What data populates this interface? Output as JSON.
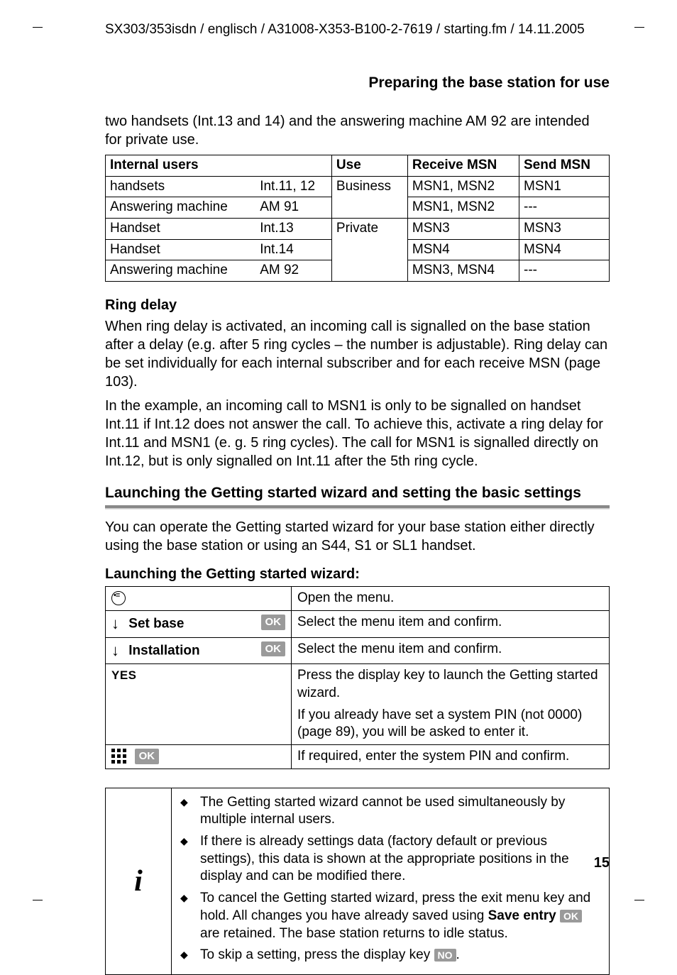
{
  "header_path": "SX303/353isdn / englisch / A31008-X353-B100-2-7619 / starting.fm / 14.11.2005",
  "section_title": "Preparing the base station for use",
  "intro_para": "two handsets (Int.13 and 14) and the answering machine AM 92 are intended for private use.",
  "table1": {
    "headers": [
      "Internal users",
      "",
      "Use",
      "Receive MSN",
      "Send MSN"
    ],
    "rows": [
      [
        "handsets",
        "Int.11, 12",
        "Business",
        "MSN1, MSN2",
        "MSN1"
      ],
      [
        "Answering machine",
        "AM 91",
        "",
        "MSN1, MSN2",
        "---"
      ],
      [
        "Handset",
        "Int.13",
        "Private",
        "MSN3",
        "MSN3"
      ],
      [
        "Handset",
        "Int.14",
        "",
        "MSN4",
        "MSN4"
      ],
      [
        "Answering machine",
        "AM 92",
        "",
        "MSN3, MSN4",
        "---"
      ]
    ]
  },
  "ring_delay": {
    "heading": "Ring delay",
    "p1": "When ring delay is activated, an incoming call is signalled on the base station after a delay (e.g. after 5 ring cycles – the number is adjustable). Ring delay can be set individually for each internal subscriber and for each receive MSN (page 103).",
    "p2": "In the example, an incoming call to MSN1 is only to be signalled on handset Int.11 if Int.12 does not answer the call. To achieve this, activate a ring delay for Int.11 and MSN1 (e. g. 5 ring cycles). The call for MSN1 is signalled directly on Int.12, but is only signalled on Int.11 after the 5th ring cycle."
  },
  "launch_heading": "Launching the Getting started wizard and setting the basic settings",
  "launch_para": "You can operate the Getting started wizard for your base station either directly using the base station or using an S44, S1 or SL1 handset.",
  "launch_sub": "Launching the Getting started wizard:",
  "steps": {
    "row1": {
      "desc": "Open the menu."
    },
    "row2": {
      "label": "Set base",
      "badge": "OK",
      "desc": "Select the menu item and confirm."
    },
    "row3": {
      "label": "Installation",
      "badge": "OK",
      "desc": "Select the menu item and confirm."
    },
    "row4": {
      "label": "YES",
      "desc1": "Press the display key to launch the Getting started wizard.",
      "desc2": "If you already have set a system PIN (not 0000) (page 89), you will be asked to enter it."
    },
    "row5": {
      "badge": "OK",
      "desc": "If required, enter the system PIN and confirm."
    }
  },
  "notes": {
    "n1": "The Getting started wizard cannot be used simultaneously by multiple internal users.",
    "n2": "If there is already settings data (factory default or previous settings), this data is shown at the appropriate positions in the display and can be modified there.",
    "n3a": "To cancel the Getting started wizard, press the exit menu key and hold. All changes you have already saved using ",
    "n3b": "Save entry",
    "n3_badge": "OK",
    "n3c": " are retained. The base station returns to idle status.",
    "n4a": "To skip a setting, press the display key ",
    "n4_badge": "NO",
    "n4b": "."
  },
  "page_number": "15"
}
